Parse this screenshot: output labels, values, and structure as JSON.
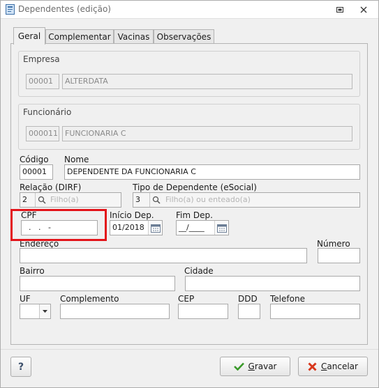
{
  "window": {
    "title": "Dependentes (edição)"
  },
  "tabs": [
    {
      "label": "Geral",
      "active": true
    },
    {
      "label": "Complementar",
      "active": false
    },
    {
      "label": "Vacinas",
      "active": false
    },
    {
      "label": "Observações",
      "active": false
    }
  ],
  "empresa": {
    "group_title": "Empresa",
    "code": "00001",
    "name": "ALTERDATA"
  },
  "funcionario": {
    "group_title": "Funcionário",
    "code": "000011",
    "name": "FUNCIONARIA C"
  },
  "form": {
    "codigo_label": "Código",
    "codigo_value": "00001",
    "nome_label": "Nome",
    "nome_value": "DEPENDENTE DA FUNCIONARIA C",
    "relacao_label": "Relação (DIRF)",
    "relacao_code": "2",
    "relacao_placeholder": "Filho(a)",
    "tipo_label": "Tipo de Dependente (eSocial)",
    "tipo_code": "3",
    "tipo_placeholder": "Filho(a) ou enteado(a)",
    "cpf_label": "CPF",
    "cpf_value": "  .   .   -",
    "inicio_label": "Início Dep.",
    "inicio_value": "01/2018",
    "fim_label": "Fim Dep.",
    "fim_value": "__/____",
    "endereco_label": "Endereço",
    "endereco_value": "",
    "numero_label": "Número",
    "numero_value": "",
    "bairro_label": "Bairro",
    "bairro_value": "",
    "cidade_label": "Cidade",
    "cidade_value": "",
    "uf_label": "UF",
    "uf_value": "",
    "complemento_label": "Complemento",
    "complemento_value": "",
    "cep_label": "CEP",
    "cep_value": "",
    "ddd_label": "DDD",
    "ddd_value": "",
    "telefone_label": "Telefone",
    "telefone_value": ""
  },
  "buttons": {
    "help": "?",
    "save_rest": "ravar",
    "save_key": "G",
    "cancel_rest": "ancelar",
    "cancel_key": "C"
  },
  "colors": {
    "highlight": "#e3141a",
    "save_icon": "#3a9a2a",
    "cancel_icon": "#d8371c"
  }
}
